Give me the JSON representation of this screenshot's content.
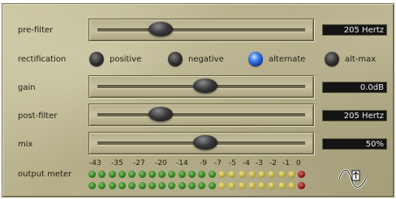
{
  "pre_filter": {
    "label": "pre-filter",
    "value": "205 Hertz",
    "level": 0.28
  },
  "rectification": {
    "label": "rectification",
    "options": [
      {
        "label": "positive",
        "selected": false
      },
      {
        "label": "negative",
        "selected": false
      },
      {
        "label": "alternate",
        "selected": true
      },
      {
        "label": "alt-max",
        "selected": false
      }
    ]
  },
  "gain": {
    "label": "gain",
    "value": "0.0dB",
    "level": 0.52
  },
  "post_filter": {
    "label": "post-filter",
    "value": "205 Hertz",
    "level": 0.28
  },
  "mix": {
    "label": "mix",
    "value": "50%",
    "level": 0.52
  },
  "output_meter": {
    "label": "output meter",
    "scale": [
      "-43",
      "-35",
      "-27",
      "-20",
      "-14",
      "-9",
      "-7",
      "-5",
      "-4",
      "-3",
      "-2",
      "-1",
      "0"
    ],
    "led_colors": [
      "g",
      "g",
      "g",
      "g",
      "g",
      "g",
      "g",
      "g",
      "g",
      "g",
      "g",
      "g",
      "g",
      "y",
      "y",
      "y",
      "y",
      "y",
      "y",
      "y",
      "y",
      "r"
    ]
  },
  "logo_icon": "waveform-logo-icon",
  "colors": {
    "selected_radio": "#3a7cf0",
    "display_bg": "#141414",
    "display_text": "#f0f0f0"
  }
}
